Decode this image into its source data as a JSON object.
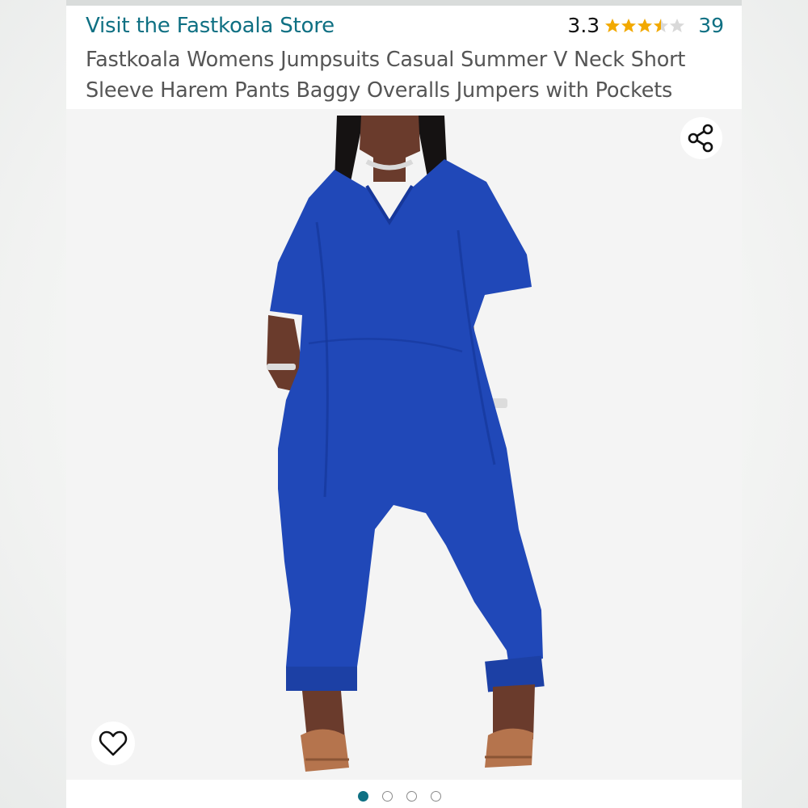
{
  "store": {
    "link_label": "Visit the Fastkoala Store"
  },
  "rating": {
    "value": "3.3",
    "stars_filled": 3.5,
    "stars_total": 5,
    "review_count": "39"
  },
  "product": {
    "title": "Fastkoala Womens Jumpsuits Casual Summer V Neck Short Sleeve Harem Pants Baggy Overalls Jumpers with Pockets"
  },
  "image": {
    "alt": "Model wearing royal blue short sleeve V-neck harem jumpsuit with pockets",
    "garment_color": "#2048b8"
  },
  "actions": {
    "share_icon": "share-icon",
    "favorite_icon": "heart-icon"
  },
  "carousel": {
    "count": 4,
    "active_index": 0
  },
  "colors": {
    "link": "#0f7083",
    "star": "#f2a900",
    "title_text": "#555555"
  }
}
